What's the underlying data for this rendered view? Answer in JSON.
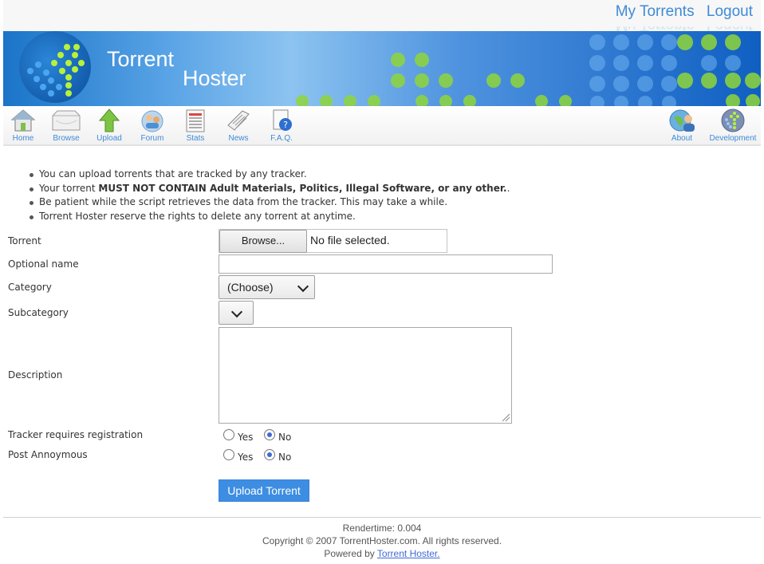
{
  "header": {
    "my_torrents": "My Torrents",
    "logout": "Logout"
  },
  "banner": {
    "brand_word1": "Torrent",
    "brand_word2": "Hoster"
  },
  "nav": {
    "home": "Home",
    "browse": "Browse",
    "upload": "Upload",
    "forum": "Forum",
    "stats": "Stats",
    "news": "News",
    "faq": "F.A.Q.",
    "about": "About",
    "development": "Development"
  },
  "rules": {
    "r1": "You can upload torrents that are tracked by any tracker.",
    "r2_prefix": "Your torrent ",
    "r2_bold": "MUST NOT CONTAIN Adult Materials, Politics, Illegal Software, or any other.",
    "r2_suffix": ".",
    "r3": "Be patient while the script retrieves the data from the tracker. This may take a while.",
    "r4": "Torrent Hoster reserve the rights to delete any torrent at anytime."
  },
  "form": {
    "torrent_label": "Torrent",
    "browse_button": "Browse...",
    "file_status": "No file selected.",
    "optional_name_label": "Optional name",
    "optional_name_value": "",
    "category_label": "Category",
    "category_value": "(Choose)",
    "subcategory_label": "Subcategory",
    "description_label": "Description",
    "tracker_reg_label": "Tracker requires registration",
    "post_anon_label": "Post Annoymous",
    "yes": "Yes",
    "no": "No",
    "submit": "Upload Torrent"
  },
  "footer": {
    "rendertime": "Rendertime: 0.004",
    "copyright": "Copyright © 2007 TorrentHoster.com. All rights reserved.",
    "powered_prefix": "Powered by ",
    "powered_link": "Torrent Hoster."
  },
  "colors": {
    "link_blue": "#3f8ad6",
    "button_blue": "#3d8de2",
    "banner_blue": "#1a74c8"
  }
}
